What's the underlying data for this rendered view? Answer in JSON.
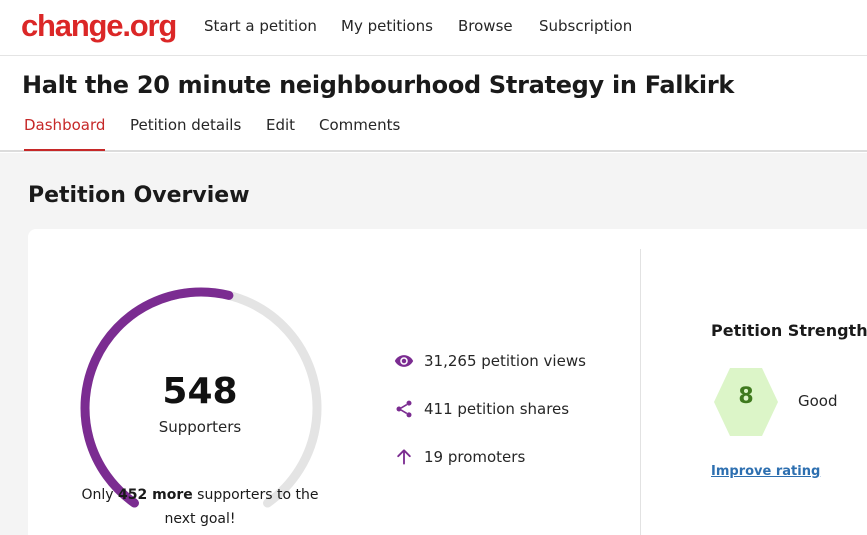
{
  "brand": {
    "logo_text": "change.org",
    "color": "#db2727"
  },
  "nav": {
    "items": [
      "Start a petition",
      "My petitions",
      "Browse",
      "Subscription"
    ]
  },
  "petition": {
    "title": "Halt the 20 minute neighbourhood Strategy in Falkirk"
  },
  "tabs": {
    "items": [
      "Dashboard",
      "Petition details",
      "Edit",
      "Comments"
    ],
    "active": "Dashboard"
  },
  "overview": {
    "heading": "Petition Overview",
    "supporters": {
      "count": "548",
      "label": "Supporters",
      "goal_progress": 0.548,
      "goal_prefix": "Only ",
      "goal_remaining": "452 more",
      "goal_suffix": " supporters to the next goal!"
    },
    "stats": [
      {
        "icon": "eye-icon",
        "text": "31,265 petition views"
      },
      {
        "icon": "share-icon",
        "text": "411 petition shares"
      },
      {
        "icon": "arrow-up-icon",
        "text": "19 promoters"
      }
    ],
    "strength": {
      "title": "Petition Strength",
      "score": "8",
      "rating": "Good",
      "improve_link": "Improve rating"
    }
  },
  "colors": {
    "progress": "#7b2c91",
    "track": "#e4e4e4",
    "hex_fill": "#dcf5c8",
    "hex_text": "#3f7a1e",
    "active_tab": "#c62828",
    "link": "#2d6fb0",
    "icon": "#7b2c91"
  }
}
